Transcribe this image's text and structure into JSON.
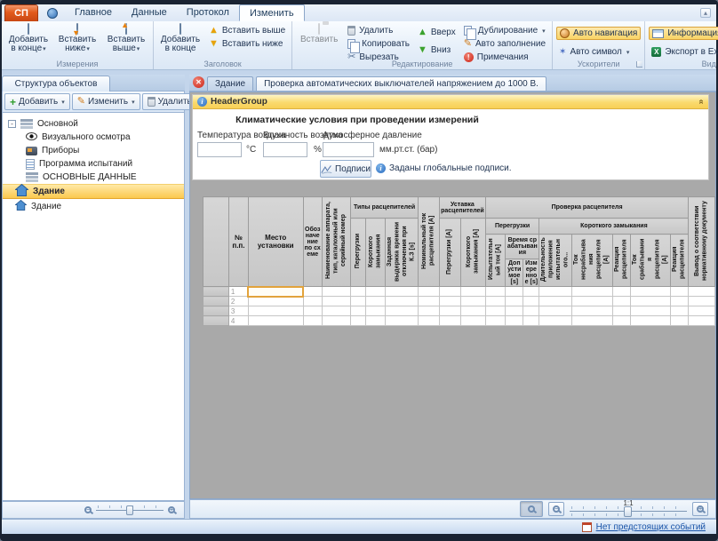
{
  "icons": {
    "dropdown": "▾",
    "plus": "+",
    "pencil": "✎",
    "cut": "✂",
    "up_arrow": "▲",
    "down_arrow": "▼",
    "alert": "!",
    "info": "i",
    "close": "✕",
    "collapse": "«",
    "excel": "X",
    "symbol": "✶",
    "minus_box": "-",
    "mag_plus": "+",
    "mag_minus": "−",
    "ribbon_min": "▴"
  },
  "ribbon": {
    "app_button": "СП",
    "tabs": {
      "home": "Главное",
      "data": "Данные",
      "protocol": "Протокол",
      "edit": "Изменить"
    },
    "measurements": {
      "label": "Измерения",
      "add_end": "Добавить в конце",
      "insert_below": "Вставить ниже",
      "insert_above": "Вставить выше"
    },
    "header": {
      "label": "Заголовок",
      "add_end": "Добавить в конце",
      "insert_above": "Вставить выше",
      "insert_below": "Вставить ниже"
    },
    "editing": {
      "label": "Редактирование",
      "paste": "Вставить",
      "del": "Удалить",
      "copy": "Копировать",
      "cut": "Вырезать",
      "up": "Вверх",
      "down": "Вниз",
      "duplicate": "Дублирование",
      "autofill": "Авто заполнение",
      "notes": "Примечания"
    },
    "accelerators": {
      "label": "Ускорители",
      "auto_nav": "Авто навигация",
      "auto_symbol": "Авто символ"
    },
    "view": {
      "label": "Вид",
      "data_info": "Информация о данных.",
      "export_excel": "Экспорт в Excel"
    }
  },
  "sidebar": {
    "title": "Структура объектов",
    "toolbar": {
      "add": "Добавить",
      "edit": "Изменить",
      "del": "Удалить"
    },
    "tree": {
      "root": "Основной",
      "visual": "Визуального осмотра",
      "devices": "Приборы",
      "program": "Программа испытаний",
      "maindata": "ОСНОВНЫЕ ДАННЫЕ",
      "building_selected": "Здание",
      "building": "Здание"
    }
  },
  "document": {
    "tab_building": "Здание",
    "tab_check": "Проверка автоматических выключателей напряжением до 1000 В.",
    "panel": {
      "title": "HeaderGroup",
      "section_title": "Климатические условия при проведении измерений",
      "temp_label": "Температура воздуха",
      "temp_value": "",
      "temp_unit": "°C",
      "hum_label": "Влажность воздуха",
      "hum_value": "",
      "hum_unit": "%",
      "press_label": "Атмосферное давление",
      "press_value": "",
      "press_unit": "мм.рт.ст. (бар)",
      "sign_btn": "Подписи",
      "sign_info": "Заданы глобальные подписи."
    }
  },
  "table": {
    "num": "№ п.п.",
    "place": "Место установки",
    "designation": "Обозначение по схеме",
    "name": "Наименование аппарата, тип, каталожный или серийный номер",
    "grp_types": "Типы расцепителей",
    "overload": "Перегрузки",
    "short": "Короткого замыкания",
    "delay": "Заданная выдержка времени отключения при К.З [s]",
    "nominal": "Номинальный ток расцепителя [А]",
    "grp_setting": "Уставка расцепителей",
    "set_overload": "Перегрузки [А]",
    "set_short": "Короткого замыкания [А]",
    "grp_check": "Проверка расцепителя",
    "chk_overload": "Перегрузки",
    "test_current": "Испытательный ток [А]",
    "grp_time": "Время срабатывания",
    "time_allowed": "Допустимое [s]",
    "time_measured": "Измеренное [s]",
    "chk_short": "Короткого замыкания",
    "duration": "Длительность приложения испытательного...",
    "no_trip": "Ток несрабатывания расцепителя [А]",
    "reaction1": "Реакция расцепителя",
    "trip": "Ток срабатывания расцепителя [А]",
    "reaction2": "Реакция расцепителя",
    "conclusion": "Вывод о соответствии нормативному документу",
    "rows": [
      "1",
      "2",
      "3",
      "4"
    ]
  },
  "zoombar": {
    "ratio": "1:1"
  },
  "statusbar": {
    "events": "Нет предстоящих событий"
  }
}
